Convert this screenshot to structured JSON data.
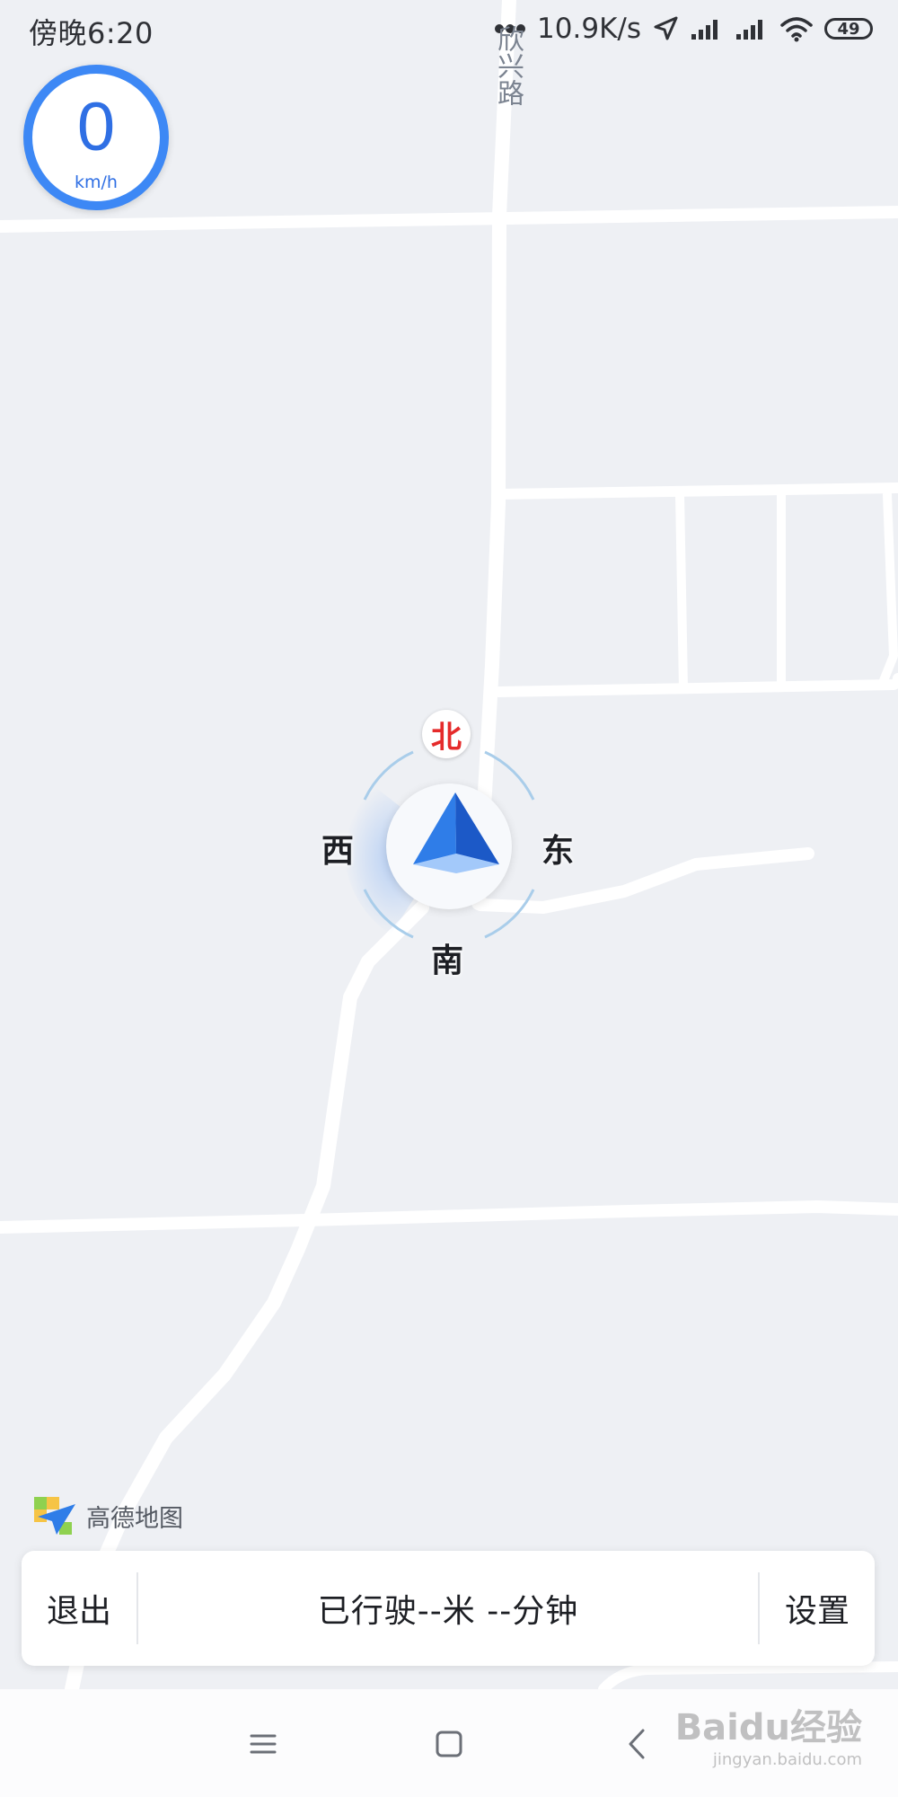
{
  "status_bar": {
    "time": "傍晚6:20",
    "network_speed": "10.9K/s",
    "battery_level": "49",
    "icons": [
      "dots-icon",
      "location-arrow-icon",
      "signal-icon",
      "signal-icon",
      "wifi-icon",
      "battery-icon"
    ]
  },
  "speedometer": {
    "value": "0",
    "unit": "km/h"
  },
  "map": {
    "road_label": "欣兴路"
  },
  "compass": {
    "north": "北",
    "east": "东",
    "south": "南",
    "west": "西"
  },
  "brand": {
    "name": "高德地图",
    "icon": "amap-logo-icon"
  },
  "bottom_panel": {
    "exit_label": "退出",
    "trip_info": "已行驶--米 --分钟",
    "settings_label": "设置"
  },
  "nav_bar": {
    "icons": [
      "menu-icon",
      "home-icon",
      "back-icon"
    ]
  },
  "watermark": {
    "logo": "Baidu经验",
    "url": "jingyan.baidu.com"
  },
  "colors": {
    "map_background": "#eef0f4",
    "road": "#ffffff",
    "accent_blue": "#3d88f5",
    "north_red": "#e52b2b"
  }
}
